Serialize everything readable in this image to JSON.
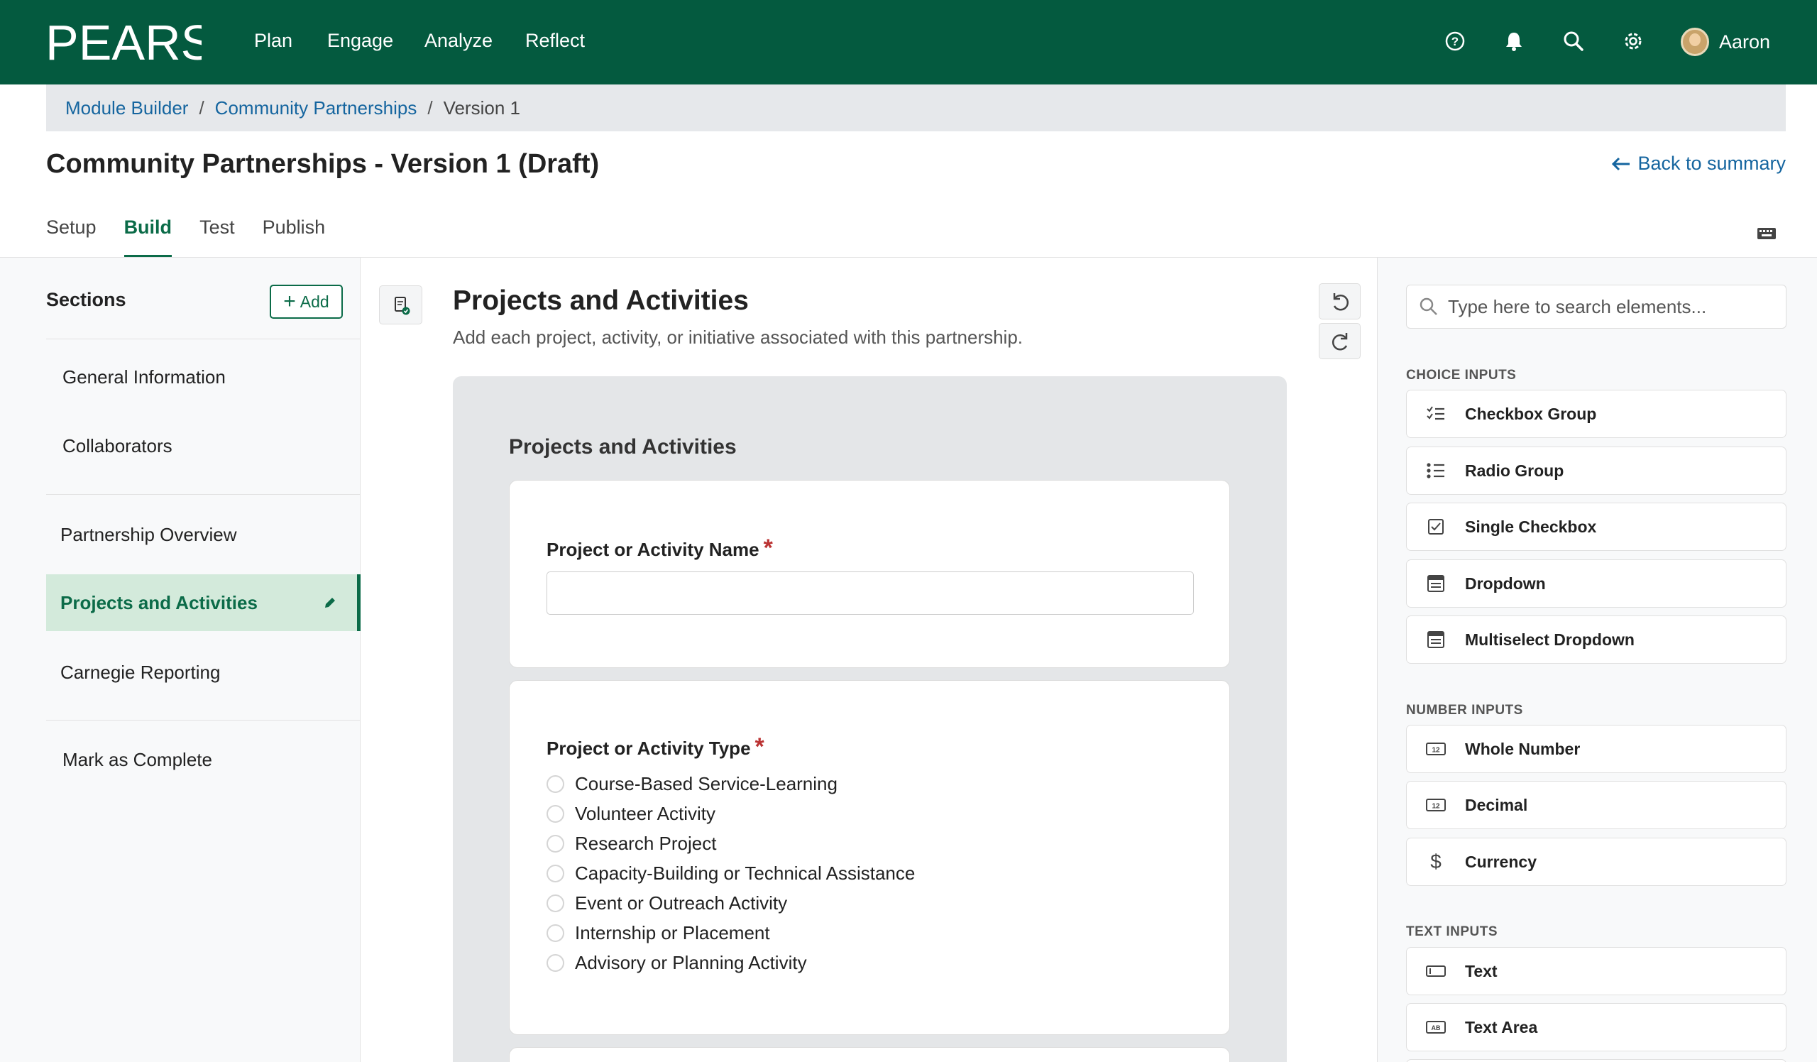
{
  "topnav": {
    "logo_text": "PEARS",
    "links": [
      "Plan",
      "Engage",
      "Analyze",
      "Reflect"
    ],
    "user_name": "Aaron",
    "colors": {
      "bar": "#045a3f",
      "accent": "#0b6b48",
      "link": "#15659f"
    }
  },
  "breadcrumb": {
    "items": [
      "Module Builder",
      "Community Partnerships"
    ],
    "separator": "/",
    "current": "Version 1"
  },
  "page": {
    "title": "Community Partnerships - Version 1 (Draft)",
    "back_link": "Back to summary"
  },
  "tabs": [
    "Setup",
    "Build",
    "Test",
    "Publish"
  ],
  "active_tab": "Build",
  "sidebar": {
    "heading": "Sections",
    "add_label": "Add",
    "items": [
      "General Information",
      "Collaborators",
      "Partnership Overview",
      "Projects and Activities",
      "Carnegie Reporting",
      "Mark as Complete"
    ],
    "active_item": "Projects and Activities"
  },
  "main": {
    "title": "Projects and Activities",
    "description": "Add each project, activity, or initiative associated with this partnership.",
    "canvas_title": "Projects and Activities",
    "fields": [
      {
        "label": "Project or Activity Name",
        "required_mark": "*",
        "type": "text",
        "value": ""
      },
      {
        "label": "Project or Activity Type",
        "required_mark": "*",
        "type": "radio",
        "options": [
          "Course-Based Service-Learning",
          "Volunteer Activity",
          "Research Project",
          "Capacity-Building or Technical Assistance",
          "Event or Outreach Activity",
          "Internship or Placement",
          "Advisory or Planning Activity"
        ]
      }
    ]
  },
  "elements_panel": {
    "search_placeholder": "Type here to search elements...",
    "groups": [
      {
        "label": "CHOICE INPUTS",
        "items": [
          {
            "label": "Checkbox Group",
            "icon": "checklist-icon"
          },
          {
            "label": "Radio Group",
            "icon": "radio-list-icon"
          },
          {
            "label": "Single Checkbox",
            "icon": "checkbox-icon"
          },
          {
            "label": "Dropdown",
            "icon": "dropdown-icon"
          },
          {
            "label": "Multiselect Dropdown",
            "icon": "multiselect-icon"
          }
        ]
      },
      {
        "label": "NUMBER INPUTS",
        "items": [
          {
            "label": "Whole Number",
            "icon": "number-12-icon"
          },
          {
            "label": "Decimal",
            "icon": "decimal-12-icon"
          },
          {
            "label": "Currency",
            "icon": "dollar-icon"
          }
        ]
      },
      {
        "label": "TEXT INPUTS",
        "items": [
          {
            "label": "Text",
            "icon": "text-input-icon"
          },
          {
            "label": "Text Area",
            "icon": "text-area-icon"
          }
        ]
      }
    ]
  }
}
